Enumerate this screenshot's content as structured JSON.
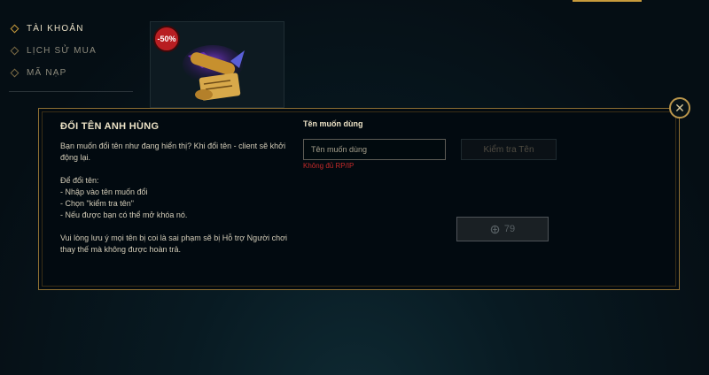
{
  "sidebar": {
    "items": [
      {
        "label": "TÀI KHOẢN",
        "active": true
      },
      {
        "label": "LỊCH SỬ MUA",
        "active": false
      },
      {
        "label": "MÃ NẠP",
        "active": false
      }
    ]
  },
  "product": {
    "discount": "-50%"
  },
  "modal": {
    "title": "ĐỔI TÊN ANH HÙNG",
    "description": {
      "intro": "Bạn muốn đổi tên như đang hiển thị? Khi đổi tên - client sẽ khởi động lại.",
      "steps_title": "Để đổi tên:",
      "steps": [
        "- Nhập vào tên muốn đổi",
        "- Chọn \"kiểm tra tên\"",
        "- Nếu được bạn có thể mở khóa nó."
      ],
      "note": "Vui lòng lưu ý mọi tên bị coi là sai phạm sẽ bị Hỗ trợ Người chơi thay thế mà không được hoàn trả."
    },
    "field_label": "Tên muốn dùng",
    "input_value": "",
    "input_placeholder": "Tên muốn dùng",
    "error": "Không đủ RP/IP",
    "check_button": "Kiểm tra Tên",
    "price": "79"
  },
  "colors": {
    "gold": "#c89b3c",
    "error": "#c42a2a",
    "badge": "#b81e22"
  },
  "icons": {
    "close": "close-icon",
    "currency": "rp-icon",
    "nav": "diamond-icon"
  }
}
